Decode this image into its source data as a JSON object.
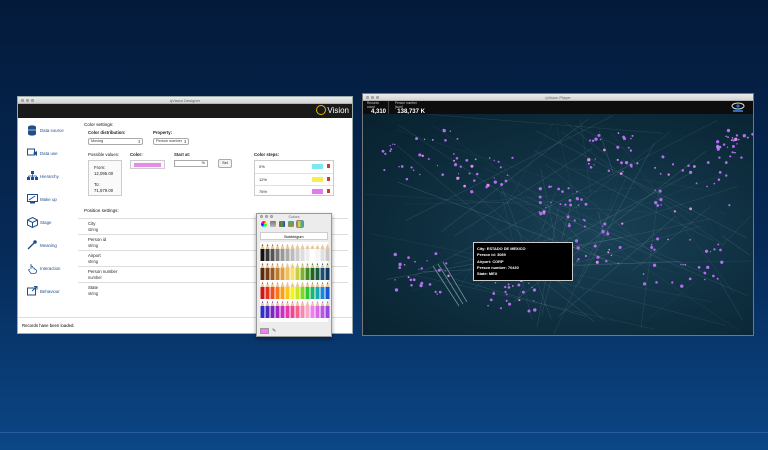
{
  "designer": {
    "title": "qVision Designer",
    "brand": "Vision",
    "sidebar": [
      {
        "label": "Data source",
        "icon": "database-icon"
      },
      {
        "label": "Data use",
        "icon": "data-use-icon"
      },
      {
        "label": "Hierarchy",
        "icon": "hierarchy-icon"
      },
      {
        "label": "Make up",
        "icon": "make-up-icon"
      },
      {
        "label": "Stage",
        "icon": "stage-icon"
      },
      {
        "label": "Meaning",
        "icon": "meaning-icon"
      },
      {
        "label": "Interaction",
        "icon": "hand-icon"
      },
      {
        "label": "Behaviour",
        "icon": "behaviour-icon"
      }
    ],
    "color_settings": {
      "title": "Color settings:",
      "distribution_label": "Color distribution:",
      "distribution_value": "Moving",
      "property_label": "Property:",
      "property_value": "Person number",
      "possible_values_label": "Possible values:",
      "from_label": "From:",
      "from_value": "12,095.00",
      "to_label": "To:",
      "to_value": "71,679.00",
      "color_label": "Color:",
      "color_value": "#e48ce8",
      "start_at_label": "Start at:",
      "start_at_value": "%",
      "start_at_placeholder": "%",
      "set_label": "Set",
      "steps_label": "Color steps:",
      "steps": [
        {
          "pct": "0%",
          "color": "#7ee8ee"
        },
        {
          "pct": "12%",
          "color": "#f4f04a"
        },
        {
          "pct": "76%",
          "color": "#e279ee"
        }
      ]
    },
    "position_settings": {
      "title": "Position settings:",
      "rows": [
        {
          "name": "City",
          "type": "string"
        },
        {
          "name": "Person id",
          "type": "string"
        },
        {
          "name": "Airport",
          "type": "string"
        },
        {
          "name": "Person number",
          "type": "number"
        },
        {
          "name": "State",
          "type": "string"
        }
      ]
    },
    "status": "Records have been loaded."
  },
  "colors_panel": {
    "title": "Colors",
    "color_name": "Bubblegum",
    "current_color": "#f07cf0",
    "tools": [
      "color-wheel-icon",
      "color-sliders-icon",
      "color-palettes-icon",
      "image-palettes-icon",
      "pencils-icon"
    ]
  },
  "player": {
    "title": "qVision Player",
    "stats": [
      {
        "label": "Records count",
        "value": "4,310"
      },
      {
        "label": "Person number [sum]",
        "value": "138,737 K"
      }
    ],
    "tooltip": [
      "City: ESTADO DE MEXICO",
      "Person id: 3089",
      "Airport: CORP",
      "Person number: 70430",
      "State: MEX"
    ]
  }
}
